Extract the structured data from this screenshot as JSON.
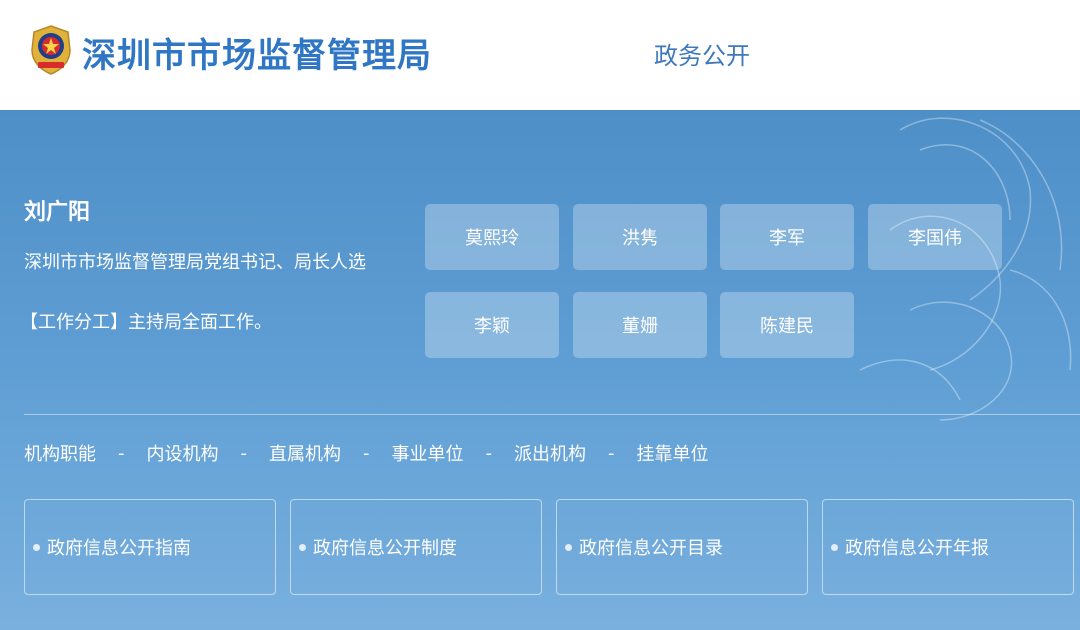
{
  "header": {
    "site_title": "深圳市市场监督管理局",
    "nav_link": "政务公开",
    "brand_color": "#2f76c4"
  },
  "leader": {
    "name": "刘广阳",
    "title": "深圳市市场监督管理局党组书记、局长人选",
    "duty": "【工作分工】主持局全面工作。"
  },
  "officials": [
    "莫熙玲",
    "洪隽",
    "李军",
    "李国伟",
    "李颖",
    "董姗",
    "陈建民"
  ],
  "org_nav": {
    "items": [
      "机构职能",
      "内设机构",
      "直属机构",
      "事业单位",
      "派出机构",
      "挂靠单位"
    ],
    "separator": "-"
  },
  "info_cards": [
    "政府信息公开指南",
    "政府信息公开制度",
    "政府信息公开目录",
    "政府信息公开年报"
  ],
  "icons": {
    "emblem": "police-emblem-icon",
    "bullet": "bullet-dot-icon"
  },
  "colors": {
    "panel_top": "#4f8fc8",
    "panel_bottom": "#79b0de",
    "text": "#ffffff"
  }
}
